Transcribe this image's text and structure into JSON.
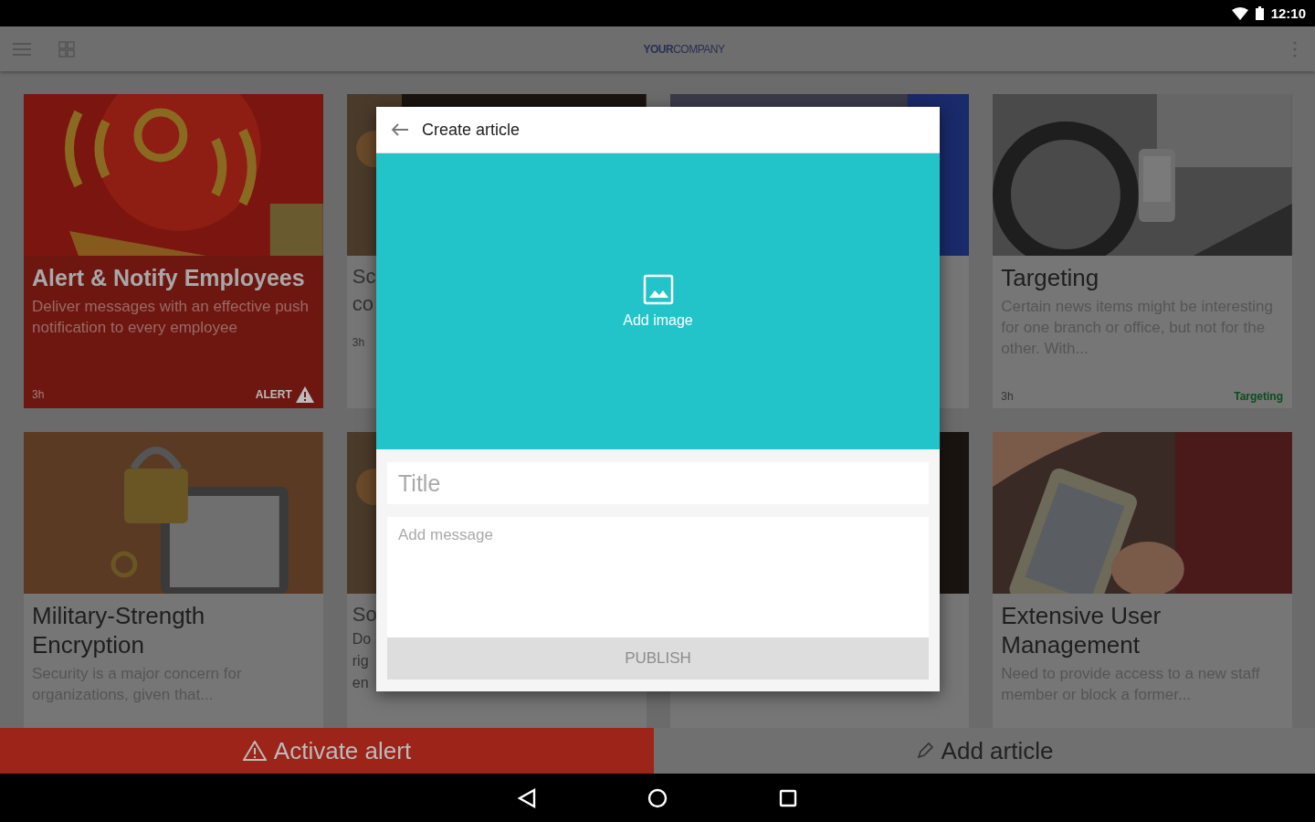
{
  "status_bar": {
    "time": "12:10"
  },
  "app_bar": {
    "logo": "**YOUR**COMPANY"
  },
  "cards": [
    {
      "kind": "alert",
      "title": "Alert & Notify Employees",
      "excerpt": "Deliver messages with an effective push notification to every employee",
      "age": "3h",
      "tag": "ALERT"
    },
    {
      "kind": "partial",
      "fragments": [
        {
          "kind": "title",
          "text": "Sc"
        },
        {
          "kind": "title",
          "text": "co"
        },
        {
          "kind": "meta",
          "text": "3h"
        }
      ]
    },
    {
      "kind": "partial"
    },
    {
      "kind": "article",
      "title": "Targeting",
      "excerpt": "Certain news items might be interesting for one branch or office, but not for the other. With...",
      "age": "3h",
      "tag": "Targeting",
      "color": "#0b4d1f"
    },
    {
      "kind": "article",
      "title": "Military-Strength Encryption",
      "excerpt": "Security is a major concern for organizations, given that..."
    },
    {
      "kind": "partial",
      "fragments": [
        {
          "kind": "title",
          "text": "So"
        },
        {
          "kind": "text",
          "text": "Do"
        },
        {
          "kind": "text",
          "text": "rig"
        },
        {
          "kind": "text",
          "text": "en"
        }
      ]
    },
    {
      "kind": "partial"
    },
    {
      "kind": "article",
      "title": "Extensive User Management",
      "excerpt": "Need to provide access to a new staff member or block a former..."
    }
  ],
  "dialog": {
    "title": "Create article",
    "add_image": "Add image",
    "title_field": {
      "placeholder": "Title"
    },
    "message_field": {
      "placeholder": "Add message"
    },
    "publish": {
      "label": "PUBLISH",
      "disabled": true
    }
  },
  "bottom_actions": [
    {
      "kind": "alert",
      "label": "Activate alert"
    },
    {
      "kind": "add",
      "label": "Add article"
    }
  ]
}
